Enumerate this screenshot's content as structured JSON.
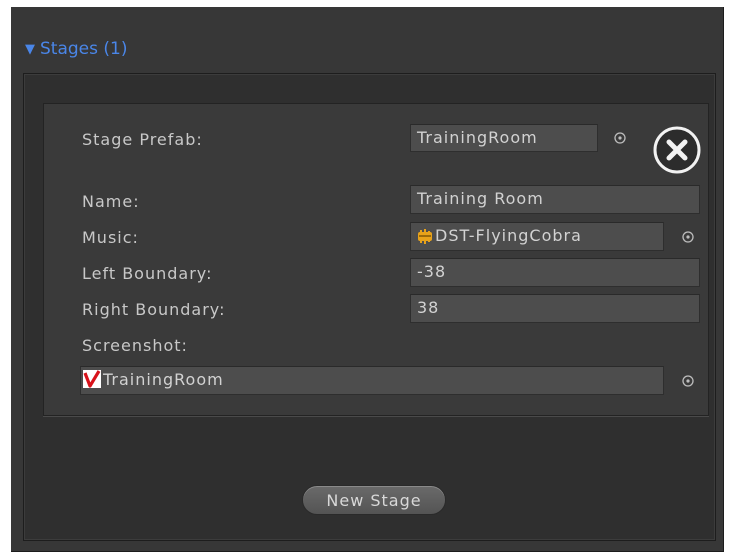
{
  "foldout": {
    "label": "Stages (1)"
  },
  "stage": {
    "prefab_label": "Stage Prefab:",
    "prefab_value": "TrainingRoom",
    "name_label": "Name:",
    "name_value": "Training Room",
    "music_label": "Music:",
    "music_value": "DST-FlyingCobra",
    "left_boundary_label": "Left Boundary:",
    "left_boundary_value": "-38",
    "right_boundary_label": "Right Boundary:",
    "right_boundary_value": "38",
    "screenshot_label": "Screenshot:",
    "screenshot_value": "TrainingRoom"
  },
  "buttons": {
    "new_stage": "New Stage"
  },
  "icons": {
    "foldout": "triangle-down-icon",
    "picker": "object-picker-icon",
    "remove": "close-circle-icon",
    "audio": "audio-clip-icon",
    "texture": "texture-icon"
  },
  "colors": {
    "accent_blue": "#4a86e8",
    "panel_dark": "#373737",
    "field_bg": "#4d4d4d",
    "text": "#c8c8c8"
  }
}
